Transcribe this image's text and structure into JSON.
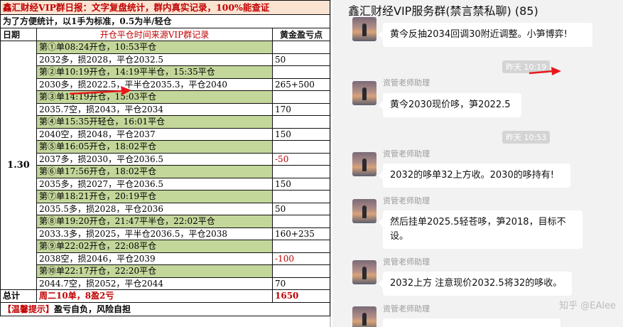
{
  "sheet": {
    "title": "鑫汇财经VIP群日报：文字复盘统计，群内真实记录，100%能查证",
    "subtitle": "为了方便统计，以1手为标准，0.5为半/轻仓",
    "headers": {
      "date": "日期",
      "record": "开仓平仓时间来源VIP群记录",
      "pnl": "黄金盈亏点"
    },
    "date": "1.30",
    "trades": [
      {
        "time": "第①单08:24开仓，10:53平仓",
        "detail": "2032多，损2028，平仓2032.5",
        "pnl": "50",
        "negative": false
      },
      {
        "time": "第②单10:19开仓，14:19平半仓，15:35平仓",
        "detail": "2030多，损2022.5，平半仓2035.3，平仓2040",
        "pnl": "265+500",
        "negative": false
      },
      {
        "time": "第③单14:19开仓，15:03平仓",
        "detail": "2035.7空，损2043，平仓2034",
        "pnl": "170",
        "negative": false
      },
      {
        "time": "第④单15:35开轻仓，16:01平仓",
        "detail": "2040空，损2048，平仓2037",
        "pnl": "150",
        "negative": false
      },
      {
        "time": "第⑤单16:05开仓，18:02平仓",
        "detail": "2037多，损2030，平仓2036.5",
        "pnl": "-50",
        "negative": true
      },
      {
        "time": "第⑥单17:56开仓，18:02平仓",
        "detail": "2035多，损2027，平仓2036.5",
        "pnl": "150",
        "negative": false
      },
      {
        "time": "第⑦单18:21开仓，20:19平仓",
        "detail": "2035.5多，损2028，平仓2036",
        "pnl": "50",
        "negative": false
      },
      {
        "time": "第⑧单19:20开仓，21:47平半仓，22:02平仓",
        "detail": "2033.3多，损2025，平半仓2036.5，平仓2038",
        "pnl": "160+235",
        "negative": false
      },
      {
        "time": "第⑨单22:02开仓，22:08平仓",
        "detail": "2038空，损2046，平仓2039",
        "pnl": "-100",
        "negative": true
      },
      {
        "time": "第⑩单22:17开仓，22:20平仓",
        "detail": "2044.7空，损2052，平仓2044",
        "pnl": "70",
        "negative": false
      }
    ],
    "total": {
      "label": "总计",
      "summary": "周二10单，8盈2亏",
      "value": "1650"
    },
    "tip": {
      "prefix": "【温馨提示】",
      "text": "盈亏自负，风险自担"
    }
  },
  "chat": {
    "title": "鑫汇财经VIP服务群(禁言禁私聊) (85)",
    "messages": [
      {
        "text": "黄今反抽2034回调30附近调整。小笋博弈!"
      },
      {
        "time": "昨天 10:19"
      },
      {
        "sender": "资管老师助理",
        "text": "黄今2030现价哆，笋2022.5"
      },
      {
        "time": "昨天 10:53"
      },
      {
        "sender": "资管老师助理",
        "text": "2032的哆单32上方收。2030的哆持有!"
      },
      {
        "sender": "资管老师助理",
        "text": "然后挂单2025.5轻苍哆，笋2018，目标不设。"
      },
      {
        "sender": "资管老师助理",
        "text": "2032上方 注意现价2032.5将32的哆收。"
      },
      {
        "sender": "资管老师助理"
      }
    ],
    "watermark": "知乎 @EAlee"
  },
  "colors": {
    "title_bg": "#fbe3d2",
    "row_green": "#c4d79b",
    "accent_red": "#c00000",
    "arrow_red": "#e8191b"
  }
}
